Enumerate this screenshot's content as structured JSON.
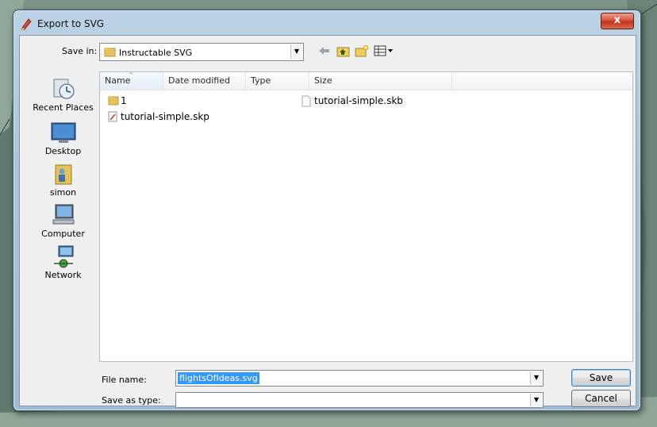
{
  "window": {
    "title": "Export to SVG",
    "close_label": "x"
  },
  "save_in": {
    "label": "Save in:",
    "value": "Instructable SVG"
  },
  "places": [
    {
      "label": "Recent Places",
      "icon": "recent-places-icon"
    },
    {
      "label": "Desktop",
      "icon": "desktop-icon"
    },
    {
      "label": "simon",
      "icon": "user-folder-icon"
    },
    {
      "label": "Computer",
      "icon": "computer-icon"
    },
    {
      "label": "Network",
      "icon": "network-icon"
    }
  ],
  "columns": [
    "Name",
    "Date modified",
    "Type",
    "Size"
  ],
  "files": [
    {
      "name": "1",
      "icon": "folder-icon"
    },
    {
      "name": "tutorial-simple.skp",
      "icon": "skp-file-icon"
    },
    {
      "name": "tutorial-simple.skb",
      "icon": "blank-file-icon"
    }
  ],
  "file_name": {
    "label": "File name:",
    "value": "flightsOfIdeas.svg"
  },
  "save_as_type": {
    "label": "Save as type:",
    "value": ""
  },
  "buttons": {
    "save": "Save",
    "cancel": "Cancel"
  },
  "colors": {
    "accent": "#3399ff",
    "close": "#c2321a",
    "title_bg": "#a9c4da"
  }
}
